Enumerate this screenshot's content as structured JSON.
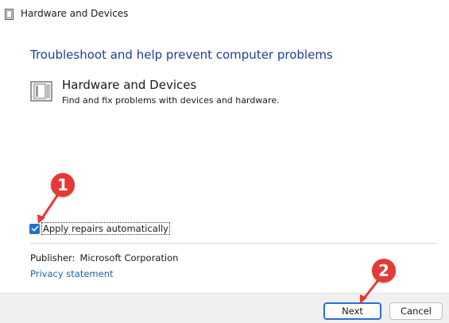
{
  "window": {
    "title": "Hardware and Devices"
  },
  "main": {
    "heading": "Troubleshoot and help prevent computer problems",
    "item": {
      "title": "Hardware and Devices",
      "description": "Find and fix problems with devices and hardware.",
      "icon": "hardware-device-icon"
    },
    "apply_repairs": {
      "label": "Apply repairs automatically",
      "checked": true
    },
    "publisher": {
      "label": "Publisher:",
      "value": "Microsoft Corporation"
    },
    "privacy_link": "Privacy statement"
  },
  "footer": {
    "next_label": "Next",
    "cancel_label": "Cancel"
  },
  "annotations": {
    "marker_1": "1",
    "marker_2": "2",
    "color": "#e53935"
  },
  "colors": {
    "heading": "#1f3d9a",
    "link": "#1f5fb0",
    "checkbox": "#1f6fd0"
  }
}
